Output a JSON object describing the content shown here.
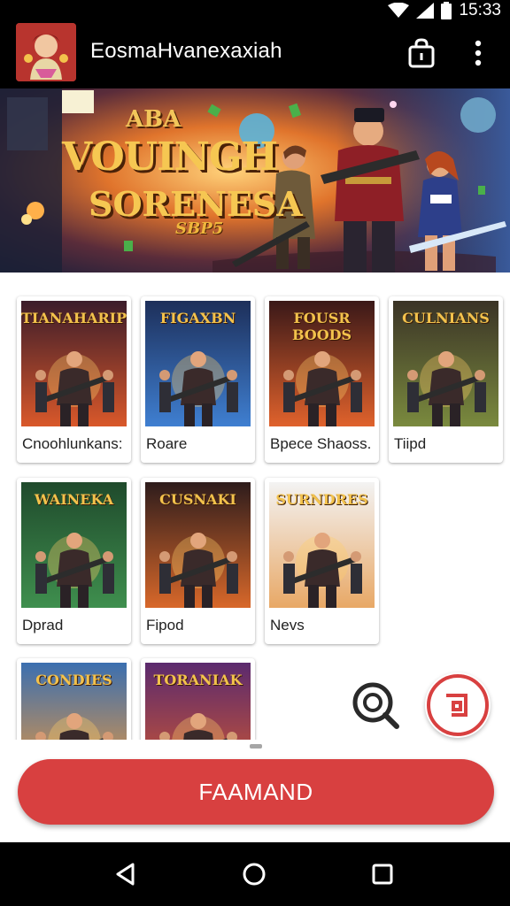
{
  "status_bar": {
    "time": "15:33",
    "icons": [
      "wifi-icon",
      "signal-icon",
      "battery-icon"
    ]
  },
  "app_bar": {
    "title": "EosmaHvanexaxiah",
    "actions": [
      "shopping-bag-icon",
      "more-vert-icon"
    ]
  },
  "hero": {
    "title_line_1": "ABA",
    "title_line_2": "VOUINGH",
    "title_line_3": "SORENESA",
    "title_line_4": "SBP5"
  },
  "games": [
    {
      "label": "Cnoohlunkans:",
      "art_title": "TIANAHARIPS",
      "palette": [
        "#3b1c2a",
        "#d9582a"
      ]
    },
    {
      "label": "Roare",
      "art_title": "FIGAXBN",
      "palette": [
        "#1d2f5a",
        "#3f7fd1"
      ]
    },
    {
      "label": "Bpece Shaoss.",
      "art_title": "FOUSR BOODS",
      "palette": [
        "#3a1818",
        "#e0622c"
      ]
    },
    {
      "label": "Tiipd",
      "art_title": "CULNIANS",
      "palette": [
        "#3a3326",
        "#7a8a3e"
      ]
    },
    {
      "label": "Dprad",
      "art_title": "WAINEKA",
      "palette": [
        "#1f4a2c",
        "#3f8f4e"
      ]
    },
    {
      "label": "Fipod",
      "art_title": "CUSNAKI",
      "palette": [
        "#2e1c1c",
        "#d8682a"
      ]
    },
    {
      "label": "Nevs",
      "art_title": "SURNDRES",
      "palette": [
        "#f3f3f3",
        "#e8a866"
      ]
    },
    {
      "label": "",
      "art_title": "CONDIES",
      "palette": [
        "#3b6fb0",
        "#f09a3a"
      ]
    },
    {
      "label": "",
      "art_title": "TORANIAK",
      "palette": [
        "#5b2a6e",
        "#d65a2e"
      ]
    }
  ],
  "floating_actions": [
    "search-icon",
    "share-icon"
  ],
  "primary_button": {
    "label": "FAAMAND",
    "color": "#d84040"
  },
  "nav_bar": {
    "buttons": [
      "back-icon",
      "home-icon",
      "recents-icon"
    ]
  },
  "colors": {
    "accent": "#d84040",
    "app_bar": "#000000"
  }
}
